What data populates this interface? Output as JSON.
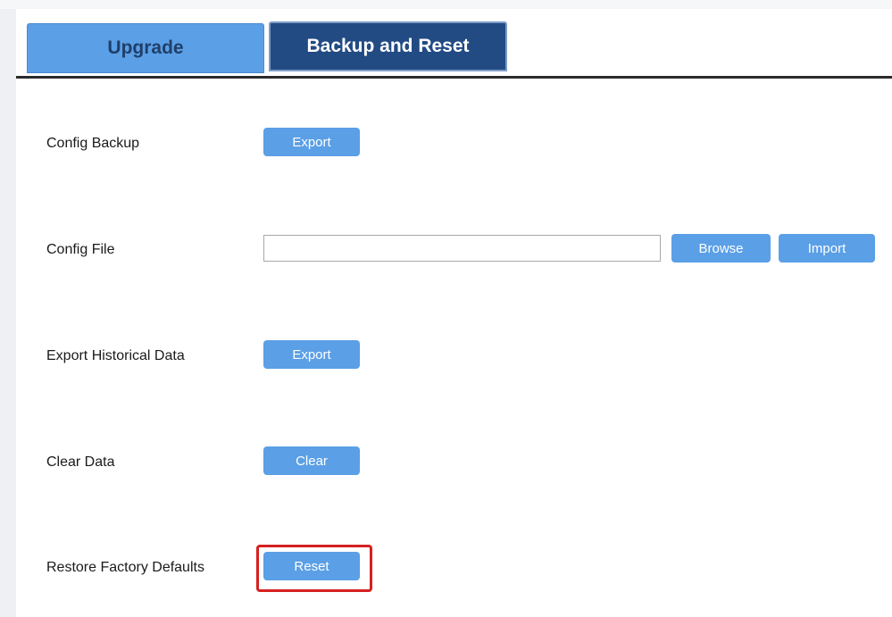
{
  "tabs": [
    {
      "label": "Upgrade",
      "active": false
    },
    {
      "label": "Backup and Reset",
      "active": true
    }
  ],
  "rows": {
    "config_backup": {
      "label": "Config Backup",
      "button": "Export"
    },
    "config_file": {
      "label": "Config File",
      "input_value": "",
      "browse": "Browse",
      "import": "Import"
    },
    "export_historical": {
      "label": "Export Historical Data",
      "button": "Export"
    },
    "clear_data": {
      "label": "Clear Data",
      "button": "Clear"
    },
    "restore_defaults": {
      "label": "Restore Factory Defaults",
      "button": "Reset"
    }
  },
  "colors": {
    "button": "#5b9fe6",
    "active_tab": "#224b84",
    "inactive_tab": "#5b9fe6",
    "highlight": "#d62020"
  }
}
